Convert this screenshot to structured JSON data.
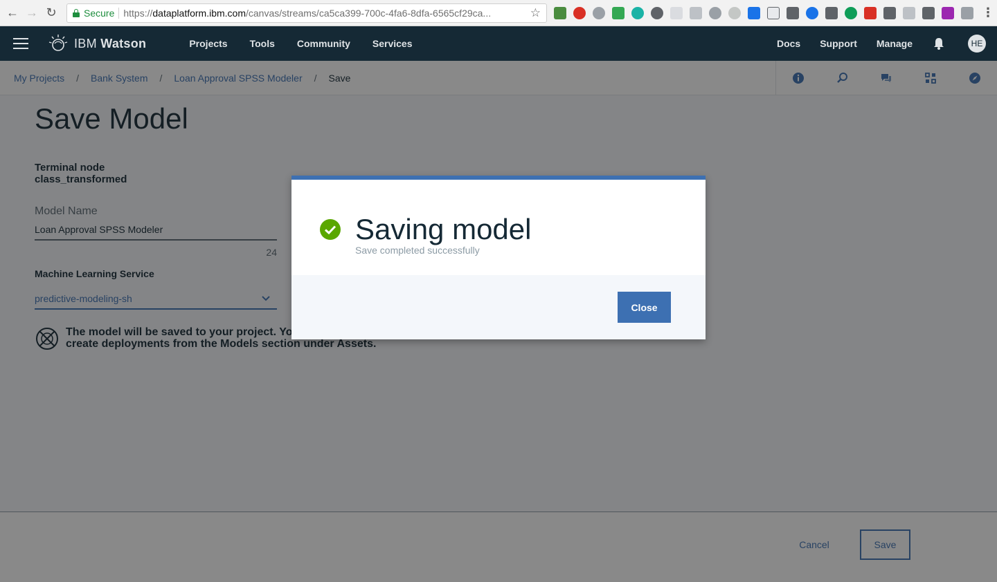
{
  "browser": {
    "secure_label": "Secure",
    "url_scheme": "https://",
    "url_host": "dataplatform.ibm.com",
    "url_path": "/canvas/streams/ca5ca399-700c-4fa6-8dfa-6565cf29ca..."
  },
  "header": {
    "brand_light": "IBM ",
    "brand_bold": "Watson",
    "nav": [
      "Projects",
      "Tools",
      "Community",
      "Services"
    ],
    "right_links": [
      "Docs",
      "Support",
      "Manage"
    ],
    "avatar_initials": "HE"
  },
  "breadcrumb": {
    "items": [
      "My Projects",
      "Bank System",
      "Loan Approval SPSS Modeler"
    ],
    "current": "Save",
    "separator": "/"
  },
  "main": {
    "title": "Save Model",
    "terminal_node_label": "Terminal node",
    "terminal_node_value": "class_transformed",
    "model_name_label": "Model Name",
    "model_name_value": "Loan Approval SPSS Modeler",
    "model_name_char_count": "24",
    "ml_service_label": "Machine Learning Service",
    "ml_service_value": "predictive-modeling-sh",
    "info_text": "The model will be saved to your project. You can access the model and create deployments from the Models section under Assets."
  },
  "footer": {
    "cancel_label": "Cancel",
    "save_label": "Save"
  },
  "modal": {
    "title": "Saving model",
    "subtitle": "Save completed successfully",
    "close_label": "Close"
  },
  "colors": {
    "header_bg": "#152935",
    "accent": "#3d70b2",
    "success": "#5aa700"
  }
}
